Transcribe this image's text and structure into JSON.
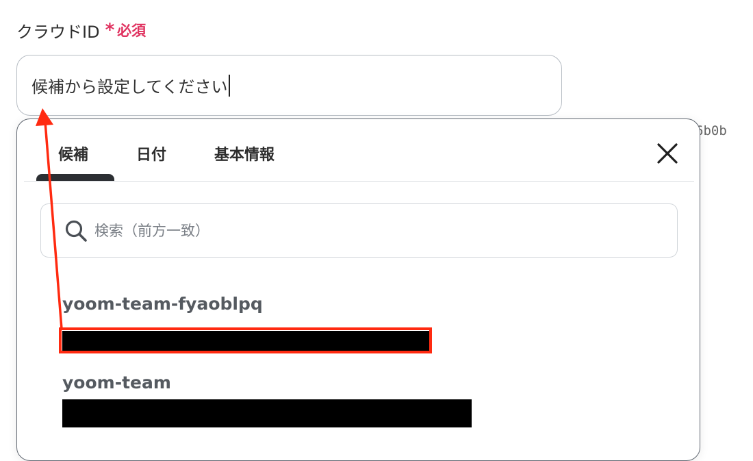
{
  "field": {
    "label": "クラウドID",
    "required_star": "*",
    "required_text": "必須"
  },
  "input": {
    "value": "候補から設定してください"
  },
  "background_text": "6b0b",
  "dropdown": {
    "tabs": [
      {
        "label": "候補",
        "active": true
      },
      {
        "label": "日付",
        "active": false
      },
      {
        "label": "基本情報",
        "active": false
      }
    ],
    "close_icon": "close-icon",
    "search": {
      "icon": "search-icon",
      "placeholder": "検索（前方一致）",
      "value": ""
    },
    "options": [
      {
        "name": "yoom-team-fyaoblpq",
        "detail_redacted": true
      },
      {
        "name": "yoom-team",
        "detail_redacted": true
      }
    ]
  },
  "annotation": {
    "color": "#ff2a10",
    "type": "arrow-from-option-to-input"
  },
  "colors": {
    "required": "#e0315f",
    "active_tab_indicator": "#2c2f33",
    "input_border": "#b6bcc3"
  }
}
